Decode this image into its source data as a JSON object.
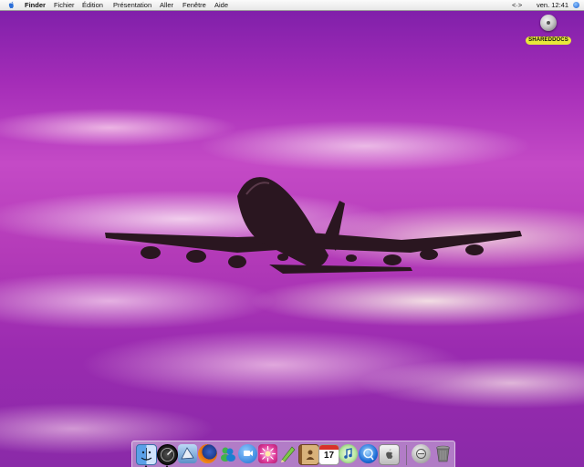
{
  "menubar": {
    "apple_icon": "apple-icon",
    "app_name": "Finder",
    "menus": [
      "Fichier",
      "Édition",
      "Présentation",
      "Aller",
      "Fenêtre",
      "Aide"
    ],
    "status_icon": "script-menu-icon",
    "status_text": "<·>",
    "clock": "ven. 12:41",
    "spotlight_icon": "blue-circle-icon"
  },
  "desktop": {
    "wallpaper": "airplane-sunset",
    "volume_label": "SHAREDDOCS",
    "volume_icon": "network-volume-icon"
  },
  "dock": {
    "apps": [
      {
        "name": "finder",
        "running": true
      },
      {
        "name": "dashboard",
        "running": true
      },
      {
        "name": "mail",
        "running": false
      },
      {
        "name": "firefox",
        "running": false
      },
      {
        "name": "msn-messenger",
        "running": false
      },
      {
        "name": "ichat",
        "running": false
      },
      {
        "name": "photo-booth",
        "running": false
      },
      {
        "name": "text-editor",
        "running": false
      },
      {
        "name": "address-book",
        "running": false
      },
      {
        "name": "ical",
        "running": false
      },
      {
        "name": "itunes",
        "running": false
      },
      {
        "name": "quicktime",
        "running": false
      },
      {
        "name": "system-preferences",
        "running": false
      }
    ],
    "ical_date": "17",
    "trash": "trash-icon",
    "downloads": "downloads-stack-icon"
  },
  "colors": {
    "sky_top": "#7b1ea8",
    "sky_mid": "#c44ac6",
    "cloud": "#ffeef6",
    "plane": "#2a1620",
    "volume_label_bg": "#e8e83a"
  }
}
